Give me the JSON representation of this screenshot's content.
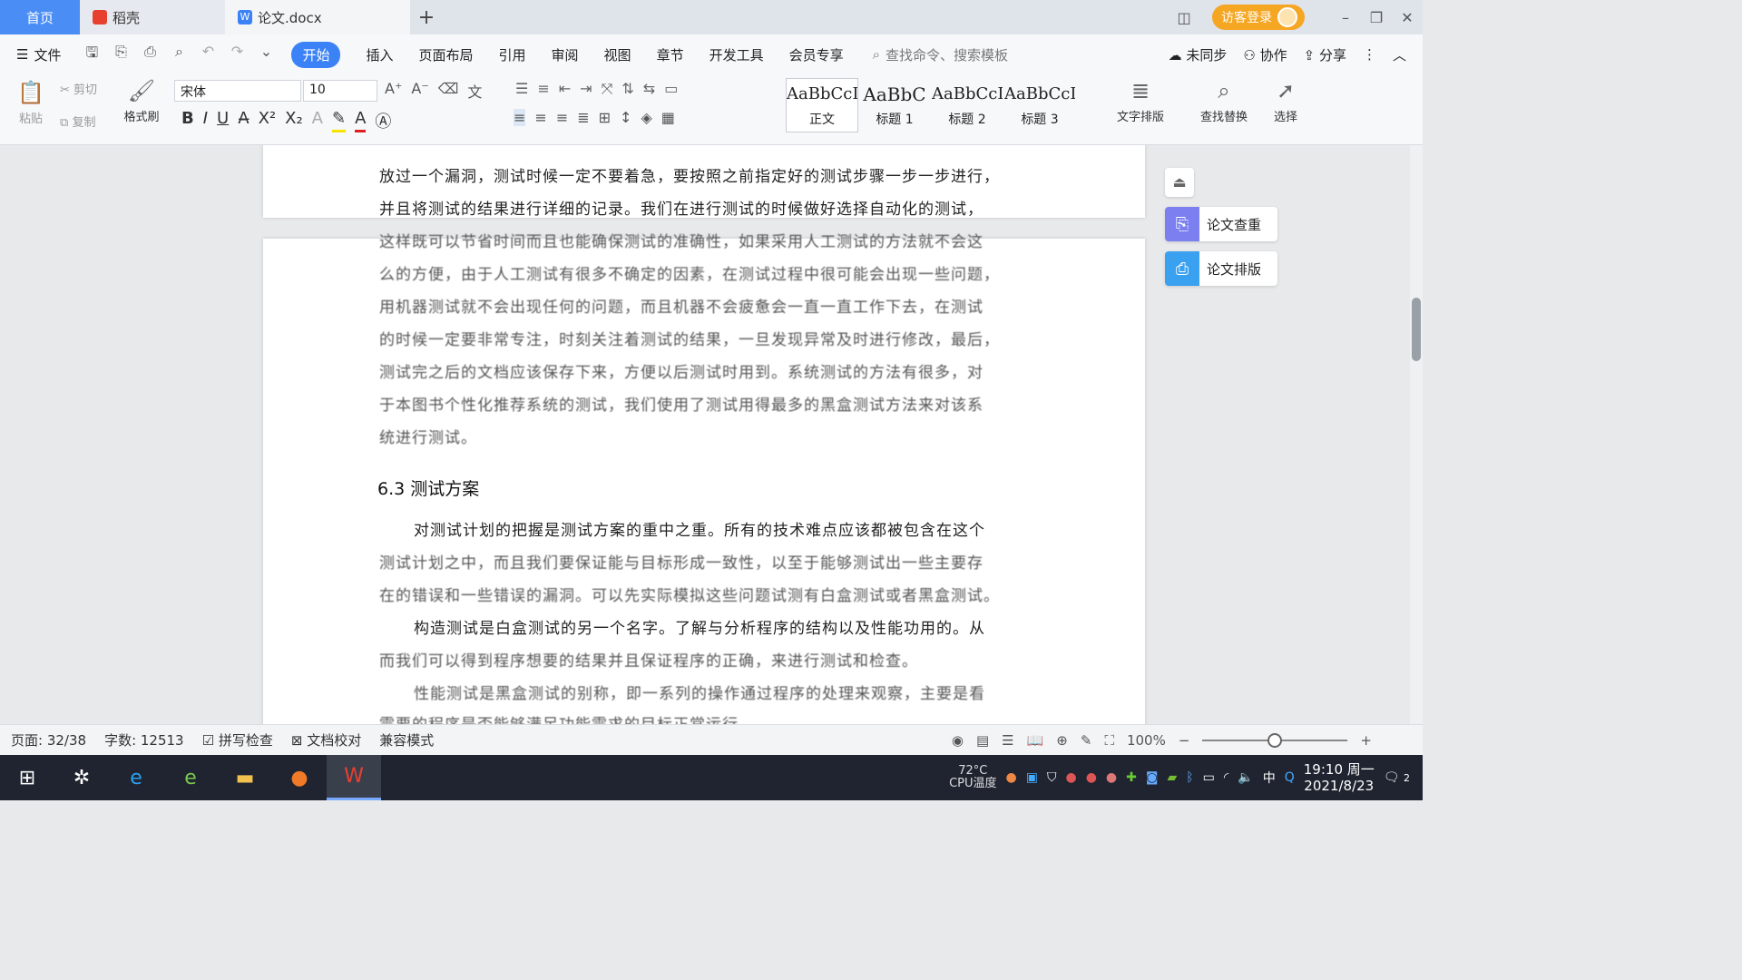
{
  "tabs": {
    "home": "首页",
    "daoke": "稻壳",
    "doc": "论文.docx",
    "add": "+"
  },
  "titlebar": {
    "login": "访客登录",
    "minimize": "–",
    "restore": "❐",
    "close": "✕"
  },
  "menu": {
    "file": "文件",
    "tabs": [
      "开始",
      "插入",
      "页面布局",
      "引用",
      "审阅",
      "视图",
      "章节",
      "开发工具",
      "会员专享"
    ],
    "search": "查找命令、搜索模板",
    "sync": "未同步",
    "collab": "协作",
    "share": "分享"
  },
  "ribbon": {
    "paste": "粘贴",
    "cut": "剪切",
    "copy": "复制",
    "format_painter": "格式刷",
    "font_name": "宋体",
    "font_size": "10",
    "styles": [
      {
        "preview": "AaBbCcI",
        "label": "正文"
      },
      {
        "preview": "AaBbC",
        "label": "标题 1"
      },
      {
        "preview": "AaBbCcI",
        "label": "标题 2"
      },
      {
        "preview": "AaBbCcI",
        "label": "标题 3"
      }
    ],
    "text_layout": "文字排版",
    "find_replace": "查找替换",
    "select": "选择"
  },
  "document": {
    "lines": [
      "放过一个漏洞，测试时候一定不要着急，要按照之前指定好的测试步骤一步一步进行，",
      "并且将测试的结果进行详细的记录。我们在进行测试的时候做好选择自动化的测试，",
      "这样既可以节省时间而且也能确保测试的准确性，如果采用人工测试的方法就不会这",
      "么的方便，由于人工测试有很多不确定的因素，在测试过程中很可能会出现一些问题，",
      "用机器测试就不会出现任何的问题，而且机器不会疲惫会一直一直工作下去，在测试",
      "的时候一定要非常专注，时刻关注着测试的结果，一旦发现异常及时进行修改，最后，",
      "测试完之后的文档应该保存下来，方便以后测试时用到。系统测试的方法有很多，对",
      "于本图书个性化推荐系统的测试，我们使用了测试用得最多的黑盒测试方法来对该系",
      "统进行测试。"
    ],
    "heading": "6.3 测试方案",
    "lines2": [
      "对测试计划的把握是测试方案的重中之重。所有的技术难点应该都被包含在这个",
      "测试计划之中，而且我们要保证能与目标形成一致性，以至于能够测试出一些主要存",
      "在的错误和一些错误的漏洞。可以先实际模拟这些问题试测有白盒测试或者黑盒测试。",
      "构造测试是白盒测试的另一个名字。了解与分析程序的结构以及性能功用的。从",
      "而我们可以得到程序想要的结果并且保证程序的正确，来进行测试和检查。",
      "性能测试是黑盒测试的别称，即一系列的操作通过程序的处理来观察，主要是看",
      "需要的程序是否能够满足功能需求的目标正常运行"
    ]
  },
  "side_panel": {
    "check": "论文查重",
    "layout": "论文排版"
  },
  "status": {
    "page": "页面: 32/38",
    "words": "字数: 12513",
    "spell": "拼写检查",
    "proof": "文档校对",
    "compat": "兼容模式",
    "zoom": "100%",
    "zoom_level": 0.5
  },
  "taskbar": {
    "cpu_temp": "72°C",
    "cpu_label": "CPU温度",
    "ime": "中",
    "time": "19:10 周一",
    "date": "2021/8/23",
    "notif": "2"
  },
  "colors": {
    "accent": "#3b82f6",
    "login": "#f5a623",
    "check_icon": "#7b7ff0",
    "layout_icon": "#3aa0f0",
    "wps_red": "#e8402f"
  }
}
